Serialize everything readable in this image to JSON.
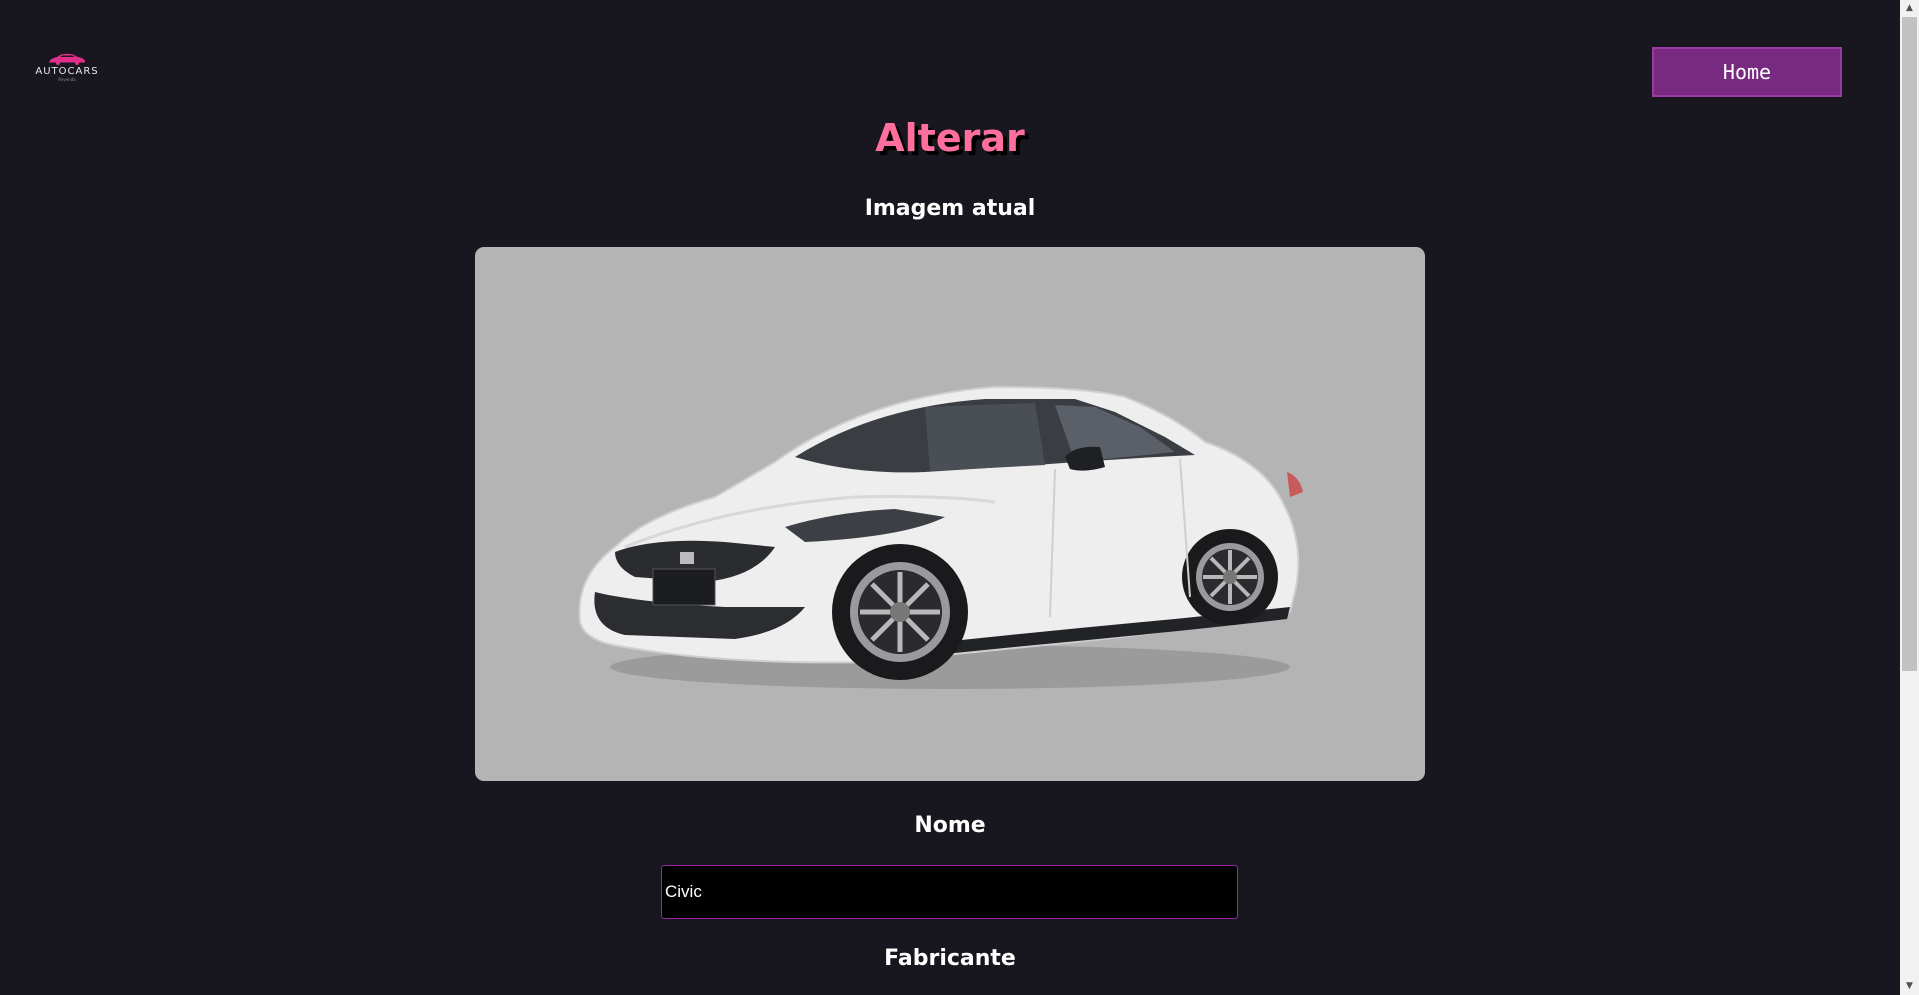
{
  "header": {
    "logo": {
      "icon": "car-logo-icon",
      "text": "AUTOCARS",
      "subtext": "Revenda"
    },
    "home_label": "Home"
  },
  "main": {
    "title": "Alterar",
    "current_image_label": "Imagem atual",
    "current_image_alt": "Honda Civic branco",
    "name_label": "Nome",
    "name_value": "Civic",
    "manufacturer_label": "Fabricante"
  },
  "colors": {
    "background": "#18171f",
    "accent_pink": "#ff6f9d",
    "button_purple": "#772a80",
    "input_border": "#a21fa8"
  }
}
